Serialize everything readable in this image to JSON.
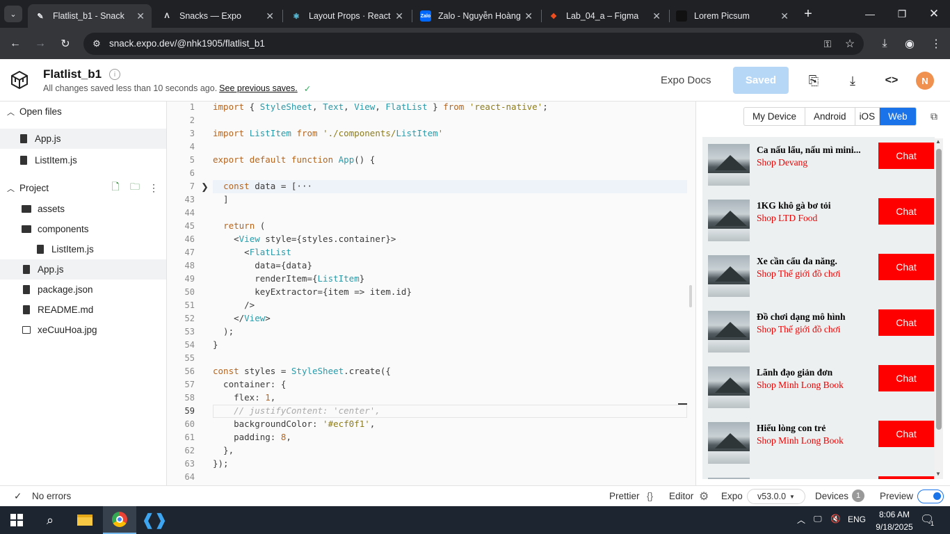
{
  "browser": {
    "tabs": [
      {
        "title": "Flatlist_b1 - Snack",
        "favicon": "snack-icon",
        "active": true
      },
      {
        "title": "Snacks — Expo",
        "favicon": "expo-icon",
        "active": false
      },
      {
        "title": "Layout Props · React N",
        "favicon": "react-icon",
        "active": false
      },
      {
        "title": "Zalo - Nguyễn Hoàng",
        "favicon": "zalo-icon",
        "active": false
      },
      {
        "title": "Lab_04_a – Figma",
        "favicon": "figma-icon",
        "active": false
      },
      {
        "title": "Lorem Picsum",
        "favicon": "picsum-icon",
        "active": false
      }
    ],
    "url": "snack.expo.dev/@nhk1905/flatlist_b1"
  },
  "header": {
    "title": "Flatlist_b1",
    "status_text": "All changes saved less than 10 seconds ago.",
    "status_link": "See previous saves.",
    "docs_label": "Expo Docs",
    "saved_label": "Saved",
    "avatar_initial": "N"
  },
  "sidebar": {
    "open_files_label": "Open files",
    "open_files": [
      "App.js",
      "ListItem.js"
    ],
    "project_label": "Project",
    "project_items": [
      {
        "name": "assets",
        "type": "folder"
      },
      {
        "name": "components",
        "type": "folder"
      },
      {
        "name": "ListItem.js",
        "type": "file"
      },
      {
        "name": "App.js",
        "type": "file"
      },
      {
        "name": "package.json",
        "type": "file"
      },
      {
        "name": "README.md",
        "type": "file"
      },
      {
        "name": "xeCuuHoa.jpg",
        "type": "image"
      }
    ]
  },
  "editor": {
    "lines": [
      {
        "n": "1",
        "text": "import { StyleSheet, Text, View, FlatList } from 'react-native';"
      },
      {
        "n": "2",
        "text": ""
      },
      {
        "n": "3",
        "text": "import ListItem from './components/ListItem'"
      },
      {
        "n": "4",
        "text": ""
      },
      {
        "n": "5",
        "text": "export default function App() {"
      },
      {
        "n": "6",
        "text": ""
      },
      {
        "n": "7",
        "text": "  const data = [···"
      },
      {
        "n": "43",
        "text": "  ]"
      },
      {
        "n": "44",
        "text": ""
      },
      {
        "n": "45",
        "text": "  return ("
      },
      {
        "n": "46",
        "text": "    <View style={styles.container}>"
      },
      {
        "n": "47",
        "text": "      <FlatList"
      },
      {
        "n": "48",
        "text": "        data={data}"
      },
      {
        "n": "49",
        "text": "        renderItem={ListItem}"
      },
      {
        "n": "50",
        "text": "        keyExtractor={item => item.id}"
      },
      {
        "n": "51",
        "text": "      />"
      },
      {
        "n": "52",
        "text": "    </View>"
      },
      {
        "n": "53",
        "text": "  );"
      },
      {
        "n": "54",
        "text": "}"
      },
      {
        "n": "55",
        "text": ""
      },
      {
        "n": "56",
        "text": "const styles = StyleSheet.create({"
      },
      {
        "n": "57",
        "text": "  container: {"
      },
      {
        "n": "58",
        "text": "    flex: 1,"
      },
      {
        "n": "59",
        "text": "    // justifyContent: 'center',"
      },
      {
        "n": "60",
        "text": "    backgroundColor: '#ecf0f1',"
      },
      {
        "n": "61",
        "text": "    padding: 8,"
      },
      {
        "n": "62",
        "text": "  },"
      },
      {
        "n": "63",
        "text": "});"
      },
      {
        "n": "64",
        "text": ""
      }
    ]
  },
  "preview": {
    "device_tabs": [
      "My Device",
      "Android",
      "iOS",
      "Web"
    ],
    "active_tab": "Web",
    "items": [
      {
        "name": "Ca nấu lẩu, nấu mì mini...",
        "shop": "Shop Devang",
        "button": "Chat"
      },
      {
        "name": "1KG khô gà bơ tỏi",
        "shop": "Shop LTD Food",
        "button": "Chat"
      },
      {
        "name": "Xe cần cẩu đa năng.",
        "shop": "Shop Thế giới đồ chơi",
        "button": "Chat"
      },
      {
        "name": "Đồ chơi dạng mô hình",
        "shop": "Shop Thế giới đồ chơi",
        "button": "Chat"
      },
      {
        "name": "Lãnh đạo giản đơn",
        "shop": "Shop Minh Long Book",
        "button": "Chat"
      },
      {
        "name": "Hiểu lòng con trẻ",
        "shop": "Shop Minh Long Book",
        "button": "Chat"
      }
    ],
    "scroll_position": 0.05
  },
  "statusbar": {
    "errors": "No errors",
    "prettier": "Prettier",
    "editor": "Editor",
    "expo": "Expo",
    "version": "v53.0.0",
    "devices": "Devices",
    "devices_count": "1",
    "preview": "Preview",
    "preview_on": true
  },
  "taskbar": {
    "lang": "ENG",
    "time": "8:06 AM",
    "date": "9/18/2025",
    "notification_count": "1"
  },
  "colors": {
    "chat_button": "#ff0000",
    "shop_text": "#e00000",
    "web_tab_active": "#1a73e8",
    "saved_button": "#b7d7f7",
    "avatar": "#f0914f",
    "preview_bg": "#ecf0f1"
  }
}
